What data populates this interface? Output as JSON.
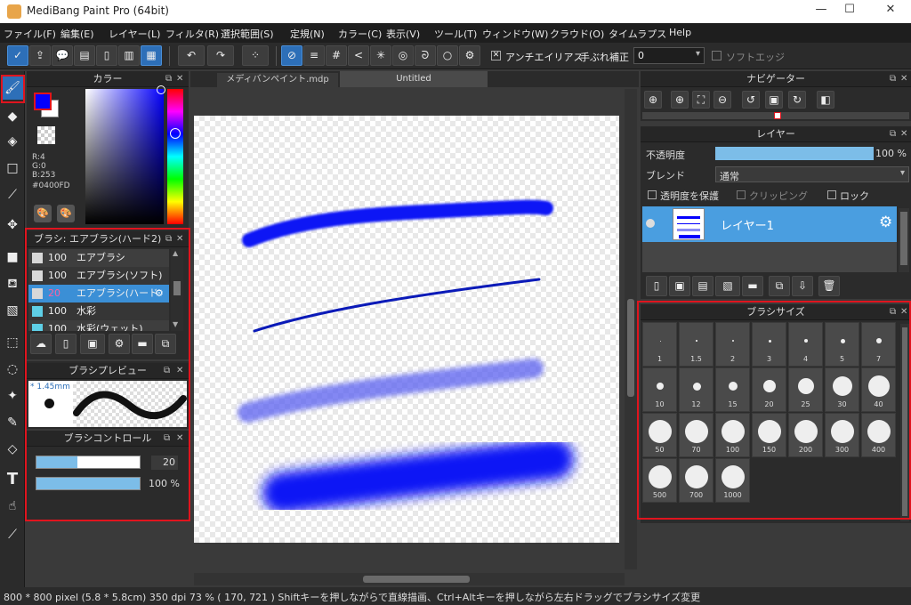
{
  "window": {
    "title": "MediBang Paint Pro (64bit)",
    "minimize": "—",
    "maximize": "☐",
    "close": "✕"
  },
  "menu": [
    "ファイル(F)",
    "編集(E)",
    "レイヤー(L)",
    "フィルタ(R)",
    "選択範囲(S)",
    "定規(N)",
    "カラー(C)",
    "表示(V)",
    "ツール(T)",
    "ウィンドウ(W)",
    "クラウド(O)",
    "タイムラプス",
    "Help"
  ],
  "toolbar": {
    "antialias": "アンチエイリアス",
    "stabilizer_label": "手ぶれ補正",
    "stabilizer_value": "0",
    "soft_edge": "ソフトエッジ"
  },
  "color_panel": {
    "title": "カラー",
    "r": "R:4",
    "g": "G:0",
    "b": "B:253",
    "hex": "#0400FD",
    "fg": "#0400fd"
  },
  "brush_panel": {
    "title": "ブラシ: エアブラシ(ハード2)",
    "items": [
      {
        "size": "100",
        "name": "エアブラシ",
        "color": "#d8d8d8"
      },
      {
        "size": "100",
        "name": "エアブラシ(ソフト)",
        "color": "#d8d8d8"
      },
      {
        "size": "20",
        "name": "エアブラシ(ハード",
        "color": "#d8d8d8"
      },
      {
        "size": "100",
        "name": "水彩",
        "color": "#5ecfe6"
      },
      {
        "size": "100",
        "name": "水彩(ウェット)",
        "color": "#5ecfe6"
      }
    ]
  },
  "brush_preview": {
    "title": "ブラシプレビュー",
    "size": "* 1.45mm"
  },
  "brush_control": {
    "title": "ブラシコントロール",
    "size_value": "20",
    "opacity_value": "100 %"
  },
  "tabs": [
    "メディバンペイント.mdp",
    "Untitled"
  ],
  "navigator": {
    "title": "ナビゲーター"
  },
  "layer_panel": {
    "title": "レイヤー",
    "opacity_label": "不透明度",
    "opacity_value": "100 %",
    "blend_label": "ブレンド",
    "blend_value": "通常",
    "protect": "透明度を保護",
    "clipping": "クリッピング",
    "lock": "ロック",
    "layer_name": "レイヤー1"
  },
  "brush_size_panel": {
    "title": "ブラシサイズ",
    "sizes": [
      "1",
      "1.5",
      "2",
      "3",
      "4",
      "5",
      "7",
      "10",
      "12",
      "15",
      "20",
      "25",
      "30",
      "40",
      "50",
      "70",
      "100",
      "150",
      "200",
      "300",
      "400",
      "500",
      "700",
      "1000"
    ]
  },
  "status": "800 * 800 pixel   (5.8 * 5.8cm)   350 dpi   73 %   ( 170, 721 )   Shiftキーを押しながらで直線描画、Ctrl+Altキーを押しながら左右ドラッグでブラシサイズ変更"
}
